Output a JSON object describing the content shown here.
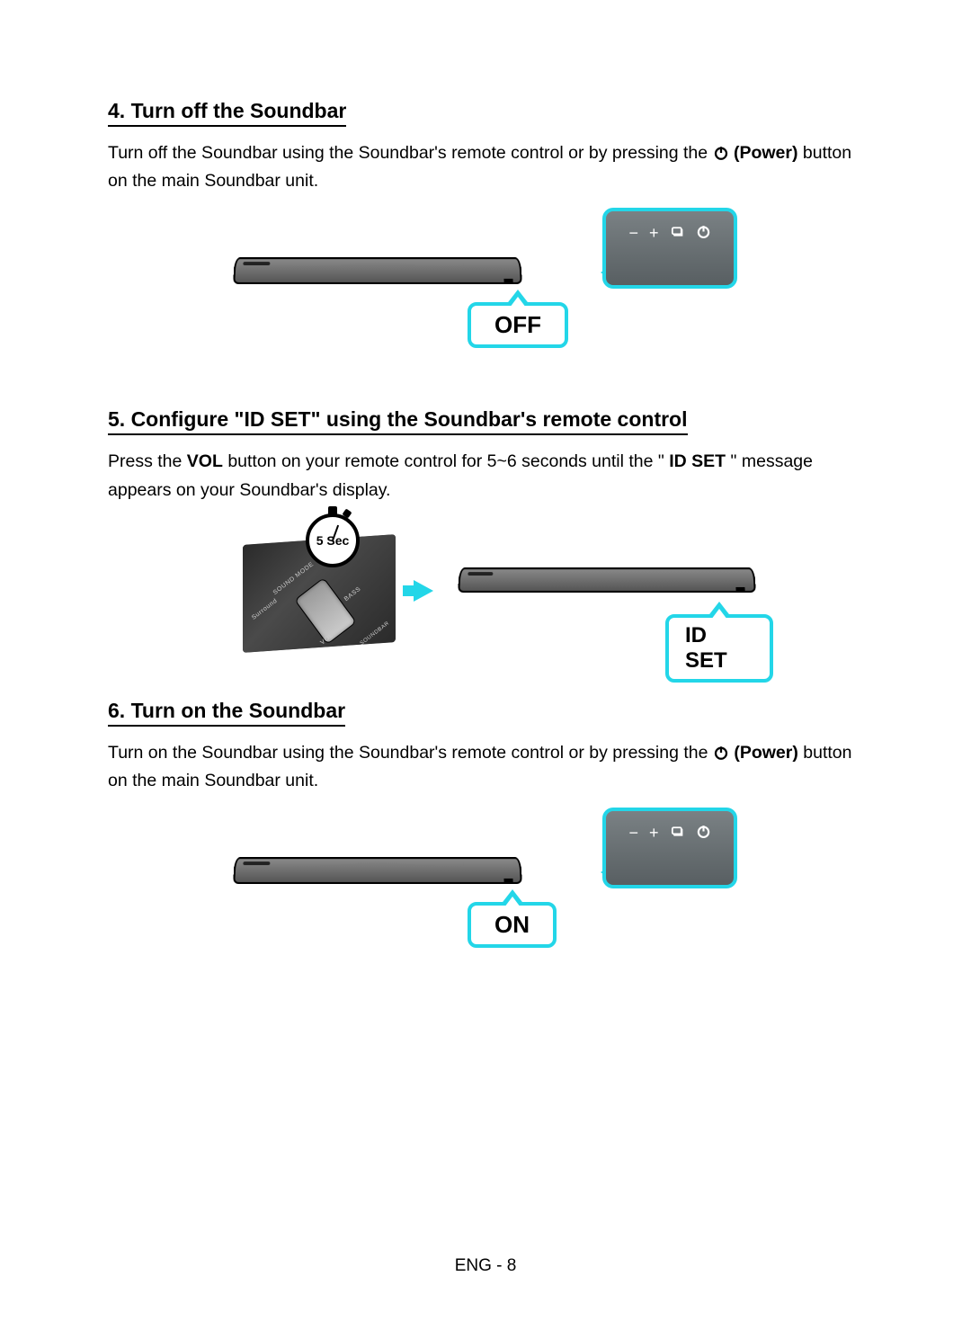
{
  "steps": {
    "s4": {
      "heading": "4. Turn off the Soundbar",
      "text_a": "Turn off the Soundbar using the Soundbar's remote control or by pressing the ",
      "power_label": "(Power)",
      "text_b": " button on the main Soundbar unit.",
      "bubble": "OFF"
    },
    "s5": {
      "heading": "5. Configure \"ID SET\" using the Soundbar's remote control",
      "text_a": "Press the ",
      "vol": "VOL",
      "text_b": " button on your remote control for 5~6 seconds until the \"",
      "idset": "ID SET",
      "text_c": "\" message appears on your Soundbar's display.",
      "stopwatch": "5 Sec",
      "bubble": "ID SET",
      "remote_labels": {
        "surround": "Surround",
        "sound_mode": "SOUND MODE",
        "bass": "BASS",
        "vol": "VOL",
        "soundbar": "SOUNDBAR"
      }
    },
    "s6": {
      "heading": "6. Turn on the Soundbar",
      "text_a": "Turn on the Soundbar using the Soundbar's remote control or by pressing the ",
      "power_label": "(Power)",
      "text_b": " button on the main Soundbar unit.",
      "bubble": "ON"
    }
  },
  "panel_icons": {
    "minus": "−",
    "plus": "+"
  },
  "footer": "ENG - 8"
}
